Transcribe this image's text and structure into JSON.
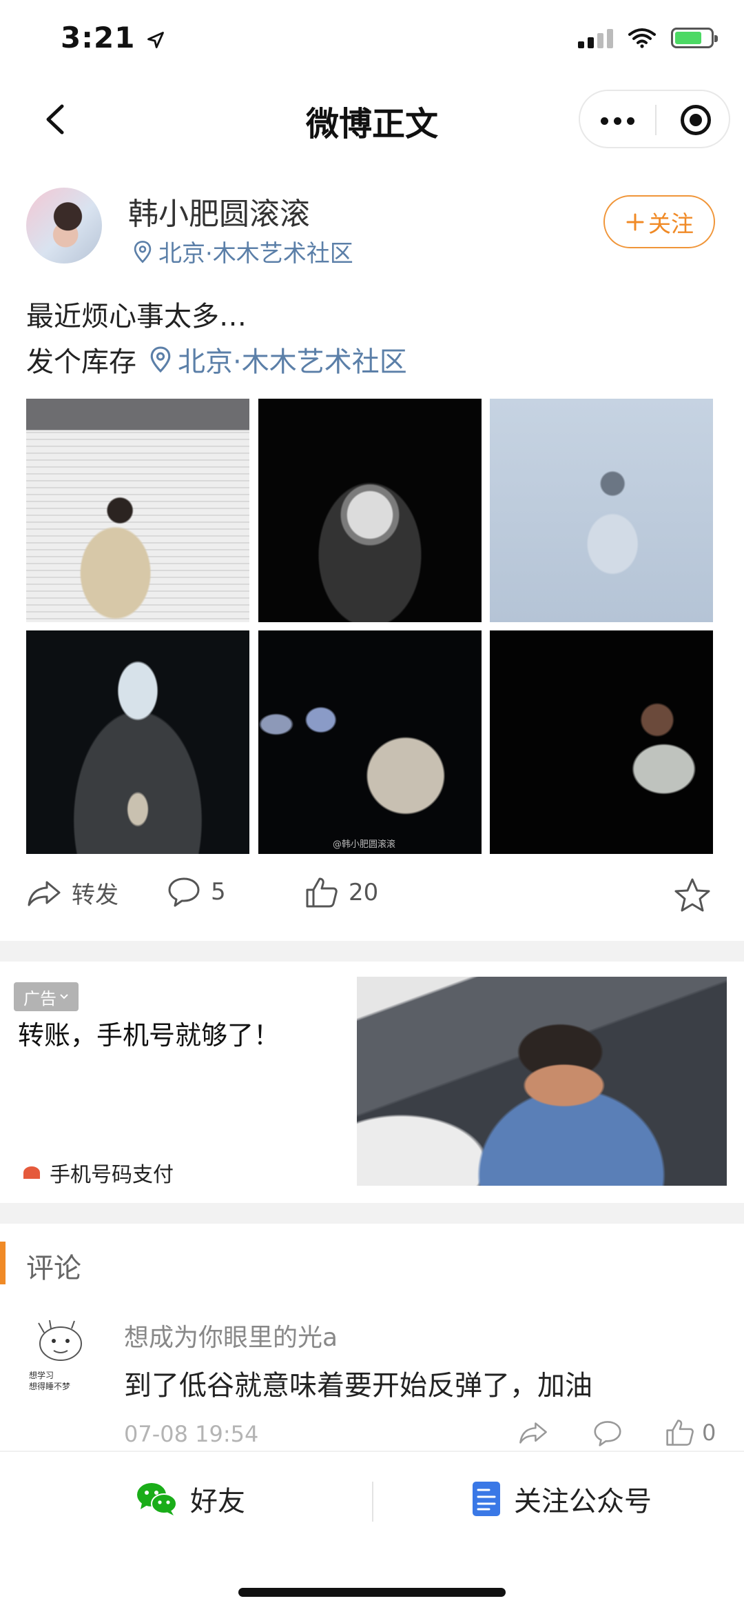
{
  "status_bar": {
    "time": "3:21"
  },
  "nav": {
    "title": "微博正文",
    "back_icon": "chevron-left-icon",
    "more_icon": "more-dots-icon",
    "close_icon": "target-icon"
  },
  "post": {
    "username": "韩小肥圆滚滚",
    "location": "北京·木木艺术社区",
    "follow_label": "关注",
    "text_line1": "最近烦心事太多…",
    "text_line2": "发个库存",
    "text_location": "北京·木木艺术社区",
    "photo_watermark": "@韩小肥圆滚滚",
    "actions": {
      "repost_label": "转发",
      "comment_count": "5",
      "like_count": "20"
    }
  },
  "ad": {
    "tag": "广告",
    "headline": "转账，手机号就够了！",
    "brand": "手机号码支付"
  },
  "comments": {
    "title": "评论",
    "items": [
      {
        "user": "想成为你眼里的光a",
        "text": "到了低谷就意味着要开始反弹了，加油",
        "time": "07-08 19:54",
        "like_count": "0",
        "avatar_caption": [
          "想学习",
          "想得睡不梦"
        ]
      }
    ]
  },
  "bottom_bar": {
    "friend_label": "好友",
    "follow_account_label": "关注公众号"
  },
  "colors": {
    "accent": "#f08a26",
    "link": "#5b7fa8",
    "wechat_green": "#1aad19",
    "doc_blue": "#3a78e6"
  }
}
